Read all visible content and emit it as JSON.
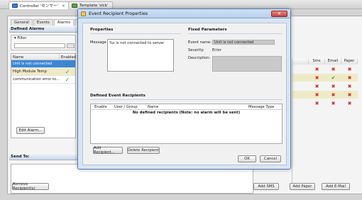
{
  "editor_tabs": [
    {
      "label": "Controller 'センサー'",
      "close": "×",
      "icon": "controller-icon"
    },
    {
      "label": "Template 'slck'",
      "icon": "template-icon"
    }
  ],
  "subtabs": [
    "General",
    "Events",
    "Alarms",
    "V"
  ],
  "defined_alarms": {
    "header": "Defined Alarms",
    "filter_label": "Filter",
    "columns": [
      "Name",
      "Enabled"
    ],
    "rows": [
      {
        "name": "Unit is not connected",
        "enabled": "✓"
      },
      {
        "name": "High Module Temp",
        "enabled": "✓"
      },
      {
        "name": "communication error to...",
        "enabled": "✓"
      }
    ],
    "edit_button": "Edit Alarm..."
  },
  "send_to": {
    "header": "Send To:",
    "remove_button": "Remove Recipient(s)"
  },
  "notification_columns": {
    "headers": [
      "",
      "Sms",
      "Email",
      "Paper"
    ],
    "rows": [
      [
        "",
        "✖",
        "✖",
        "✖"
      ],
      [
        "",
        "✖",
        "✔",
        "✖"
      ],
      [
        "",
        "✖",
        "✖",
        "✖"
      ],
      [
        "",
        "✖",
        "✖",
        "✖"
      ],
      [
        "",
        "✖",
        "✖",
        "✖"
      ]
    ],
    "add_sms": "Add SMS",
    "add_paper": "Add Paper",
    "add_email": "Add E-Mail"
  },
  "dialog": {
    "title": "Event Recipient Properties",
    "close": "✕",
    "properties_title": "Properties",
    "message_label": "Message",
    "message_value": "%s is not connected to server",
    "fixed_title": "Fixed Parameters",
    "event_name_label": "Event name:",
    "event_name_value": "Unit is not connected",
    "severity_label": "Severity:",
    "severity_value": "Error",
    "description_label": "Description:",
    "recipients_title": "Defined Event Recipients",
    "recipient_columns": {
      "enable": "Enable",
      "user": "User / Group",
      "name": "Name",
      "msg_type": "Message Type"
    },
    "empty_text": "No defined recipients (Note: no alarm will be sent)",
    "add_recipient": "Add Recipient...",
    "delete_recipient": "Delete Recipient",
    "ok": "OK",
    "cancel": "Cancel"
  }
}
